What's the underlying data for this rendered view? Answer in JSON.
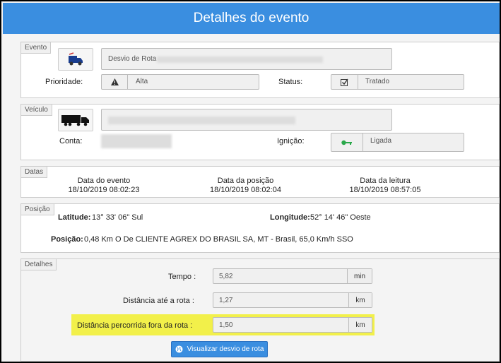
{
  "header": {
    "title": "Detalhes do evento"
  },
  "evento": {
    "legend": "Evento",
    "name": "Desvio de Rota",
    "prioridade_label": "Prioridade:",
    "prioridade_value": "Alta",
    "status_label": "Status:",
    "status_value": "Tratado"
  },
  "veiculo": {
    "legend": "Veículo",
    "conta_label": "Conta:",
    "ignicao_label": "Ignição:",
    "ignicao_value": "Ligada"
  },
  "datas": {
    "legend": "Datas",
    "evento_label": "Data do evento",
    "evento_value": "18/10/2019 08:02:23",
    "posicao_label": "Data da posição",
    "posicao_value": "18/10/2019 08:02:04",
    "leitura_label": "Data da leitura",
    "leitura_value": "18/10/2019 08:57:05"
  },
  "posicao": {
    "legend": "Posição",
    "latitude_label": "Latitude:",
    "latitude_value": "13° 33' 06\" Sul",
    "longitude_label": "Longitude:",
    "longitude_value": "52° 14' 46\" Oeste",
    "posicao_label": "Posição:",
    "posicao_value": "0,48 Km O De CLIENTE AGREX DO BRASIL SA, MT - Brasil, 65,0 Km/h SSO"
  },
  "detalhes": {
    "legend": "Detalhes",
    "tempo_label": "Tempo :",
    "tempo_value": "5,82",
    "tempo_unit": "min",
    "dist_rota_label": "Distância até a rota :",
    "dist_rota_value": "1,27",
    "dist_rota_unit": "km",
    "dist_fora_label": "Distância percorrida fora da rota :",
    "dist_fora_value": "1,50",
    "dist_fora_unit": "km",
    "button_label": "Visualizar desvio de rota"
  },
  "colors": {
    "header": "#3a8ee0",
    "highlight": "#f2f04a",
    "key_icon": "#2aa84a"
  }
}
